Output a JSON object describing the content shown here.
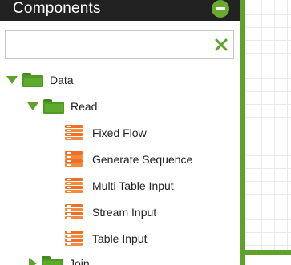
{
  "panel": {
    "title": "Components",
    "collapse_icon": "minus-circle-icon",
    "accent_color": "#5fa12a",
    "header_color": "#222222"
  },
  "search": {
    "value": "",
    "placeholder": "",
    "clear_icon": "close-x-icon"
  },
  "tree": {
    "data": {
      "label": "Data",
      "expanded": true,
      "icon": "folder-icon"
    },
    "read": {
      "label": "Read",
      "expanded": true,
      "icon": "folder-icon",
      "items": [
        {
          "label": "Fixed Flow",
          "icon": "step-icon"
        },
        {
          "label": "Generate Sequence",
          "icon": "step-icon"
        },
        {
          "label": "Multi Table Input",
          "icon": "step-icon"
        },
        {
          "label": "Stream Input",
          "icon": "step-icon"
        },
        {
          "label": "Table Input",
          "icon": "step-icon"
        }
      ]
    },
    "join": {
      "label": "Join",
      "expanded": false,
      "icon": "folder-icon"
    }
  }
}
